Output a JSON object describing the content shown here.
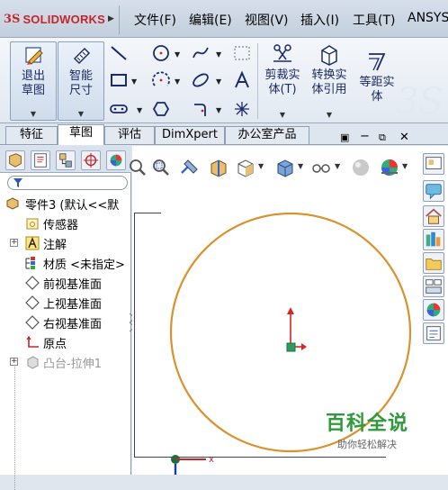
{
  "app": {
    "logo_prefix": "3S",
    "logo_name": "SOLIDWORKS"
  },
  "menu": [
    "文件(F)",
    "编辑(E)",
    "视图(V)",
    "插入(I)",
    "工具(T)",
    "ANSYS"
  ],
  "ribbon": {
    "exit_sketch": "退出草图",
    "smart_dimension": "智能尺寸",
    "trim": "剪裁实体(T)",
    "convert": "转换实体引用",
    "offset": "等距实体"
  },
  "tabs": [
    "特征",
    "草图",
    "评估",
    "DimXpert",
    "办公室产品"
  ],
  "active_tab": "草图",
  "tree": {
    "part": "零件3 (默认<<默",
    "items": [
      "传感器",
      "注解",
      "材质 <未指定>",
      "前视基准面",
      "上视基准面",
      "右视基准面",
      "原点",
      "凸台-拉伸1"
    ]
  },
  "axis_label": "x",
  "watermark": {
    "title": "百科全说",
    "subtitle": "助你轻松解决"
  },
  "colors": {
    "circle": "#d9922e",
    "accent_red": "#c3262a",
    "wm_green": "#2e9a3c"
  }
}
